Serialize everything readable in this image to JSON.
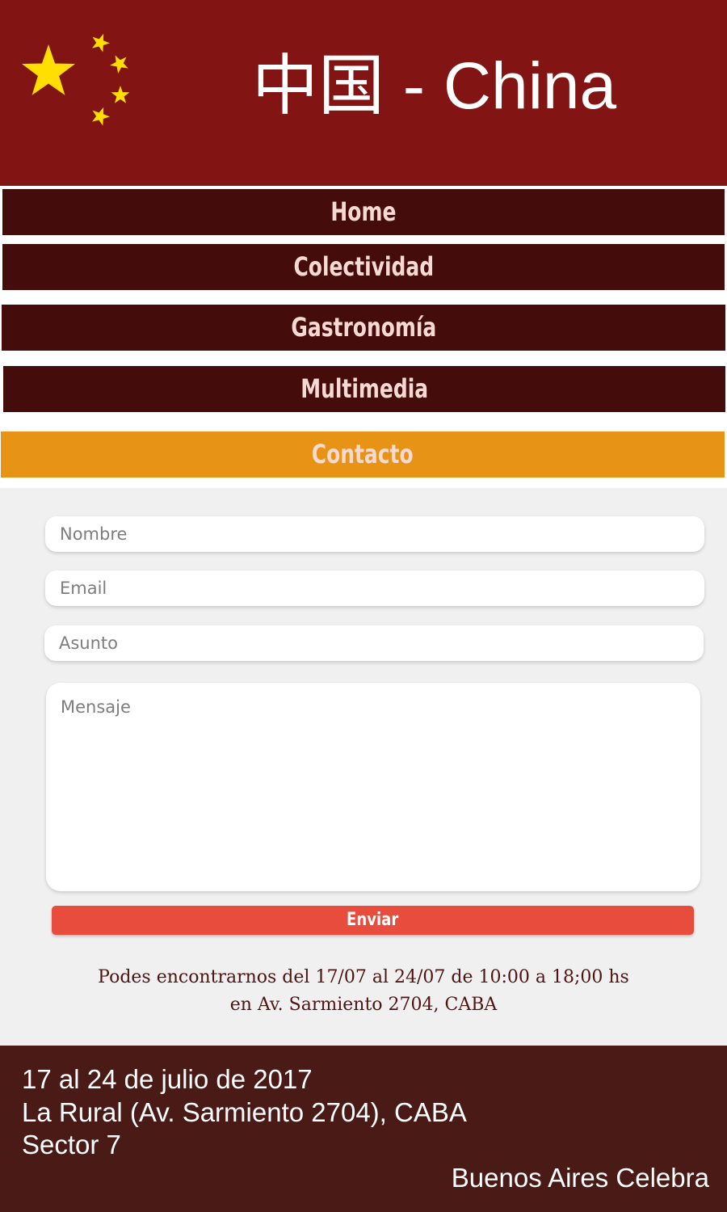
{
  "header": {
    "title": "中国 - China",
    "flag_icon": "china-flag-stars-icon",
    "background": "#821513",
    "star_color": "#ffde00"
  },
  "nav": {
    "items": [
      {
        "label": "Home",
        "active": false
      },
      {
        "label": "Colectividad",
        "active": false
      },
      {
        "label": "Gastronomía",
        "active": false
      },
      {
        "label": "Multimedia",
        "active": false
      },
      {
        "label": "Contacto",
        "active": true
      }
    ],
    "color": "#440c0b",
    "active_color": "#e69316"
  },
  "form": {
    "name_placeholder": "Nombre",
    "email_placeholder": "Email",
    "subject_placeholder": "Asunto",
    "message_placeholder": "Mensaje",
    "send_label": "Enviar",
    "send_color": "#e84c3d"
  },
  "info": {
    "line1": "Podes encontrarnos del 17/07 al 24/07 de 10:00 a 18;00 hs",
    "line2": "en Av. Sarmiento 2704, CABA"
  },
  "footer": {
    "line1": "17 al 24 de julio de 2017",
    "line2": "La Rural (Av. Sarmiento 2704), CABA",
    "line3": "Sector 7",
    "brand": "Buenos Aires Celebra",
    "background": "#4a1a17"
  }
}
